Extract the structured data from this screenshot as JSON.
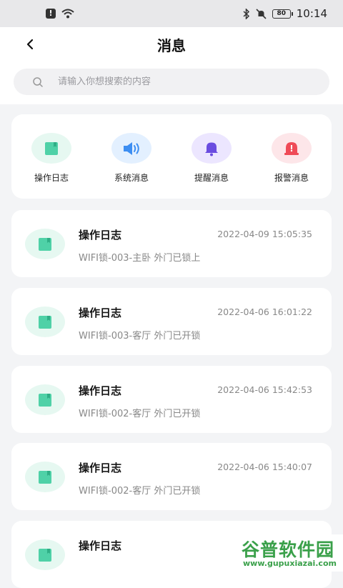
{
  "status_bar": {
    "battery": "80",
    "time": "10:14"
  },
  "header": {
    "title": "消息"
  },
  "search": {
    "placeholder": "请输入你想搜索的内容"
  },
  "categories": [
    {
      "label": "操作日志",
      "icon": "notebook-icon",
      "color": "#4fd1a7",
      "bg": "#e6f8f1"
    },
    {
      "label": "系统消息",
      "icon": "speaker-icon",
      "color": "#3d8ef2",
      "bg": "#e3f0ff"
    },
    {
      "label": "提醒消息",
      "icon": "bell-icon",
      "color": "#6a4ce0",
      "bg": "#ece6ff"
    },
    {
      "label": "报警消息",
      "icon": "alarm-icon",
      "color": "#ef4b57",
      "bg": "#fde6e9"
    }
  ],
  "messages": [
    {
      "title": "操作日志",
      "time": "2022-04-09 15:05:35",
      "body": "WIFI锁-003-主卧 外门已锁上"
    },
    {
      "title": "操作日志",
      "time": "2022-04-06 16:01:22",
      "body": "WIFI锁-003-客厅 外门已开锁"
    },
    {
      "title": "操作日志",
      "time": "2022-04-06 15:42:53",
      "body": "WIFI锁-002-客厅 外门已开锁"
    },
    {
      "title": "操作日志",
      "time": "2022-04-06 15:40:07",
      "body": "WIFI锁-002-客厅 外门已开锁"
    },
    {
      "title": "操作日志",
      "time": "",
      "body": ""
    }
  ],
  "watermark": {
    "main": "谷普软件园",
    "sub": "www.gupuxiazai.com"
  }
}
